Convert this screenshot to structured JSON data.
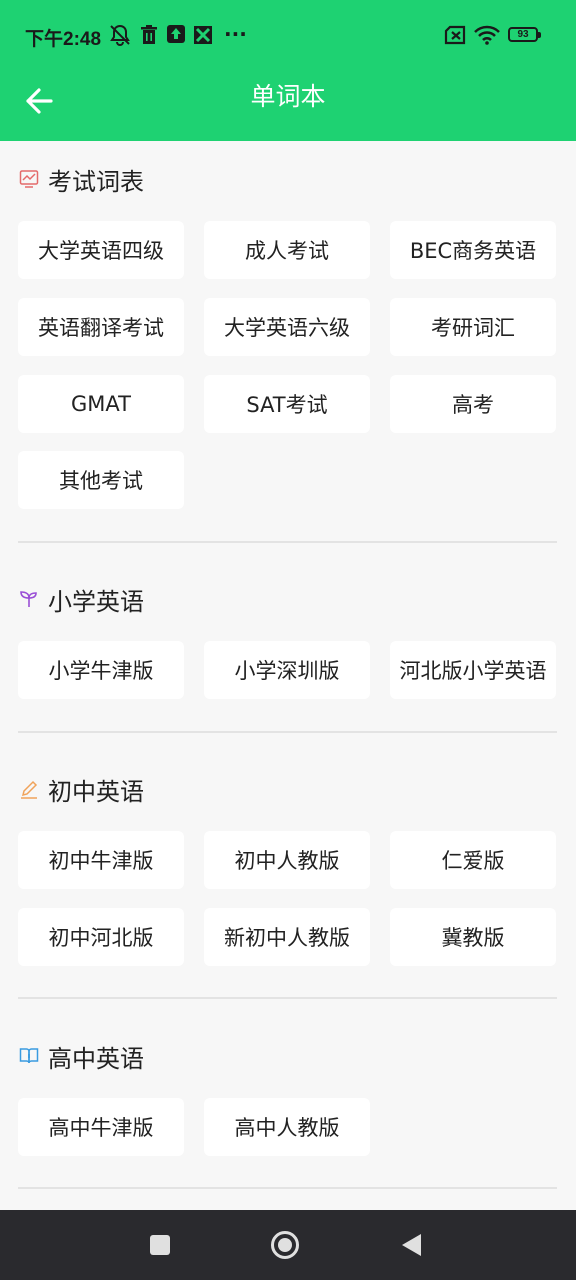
{
  "status": {
    "time": "下午2:48",
    "battery": "93"
  },
  "header": {
    "title": "单词本"
  },
  "sections": [
    {
      "title": "考试词表",
      "icon": "chart-icon",
      "items": [
        "大学英语四级",
        "成人考试",
        "BEC商务英语",
        "英语翻译考试",
        "大学英语六级",
        "考研词汇",
        "GMAT",
        "SAT考试",
        "高考",
        "其他考试"
      ]
    },
    {
      "title": "小学英语",
      "icon": "sprout-icon",
      "items": [
        "小学牛津版",
        "小学深圳版",
        "河北版小学英语"
      ]
    },
    {
      "title": "初中英语",
      "icon": "pencil-icon",
      "items": [
        "初中牛津版",
        "初中人教版",
        "仁爱版",
        "初中河北版",
        "新初中人教版",
        "冀教版"
      ]
    },
    {
      "title": "高中英语",
      "icon": "book-icon",
      "items": [
        "高中牛津版",
        "高中人教版"
      ]
    }
  ],
  "colors": {
    "accent": "#1ed272",
    "icon_red": "#e46a6a",
    "icon_purple": "#9a4fd6",
    "icon_orange": "#f0a35a",
    "icon_blue": "#3a9be0"
  }
}
